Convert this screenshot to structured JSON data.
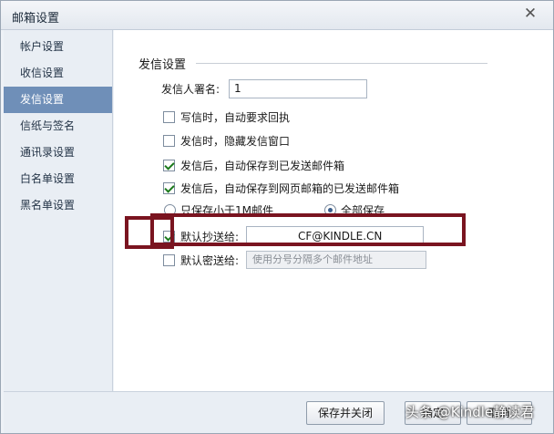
{
  "window": {
    "title": "邮箱设置",
    "close_glyph": "✕"
  },
  "sidebar": {
    "items": [
      {
        "label": "帐户设置",
        "active": false
      },
      {
        "label": "收信设置",
        "active": false
      },
      {
        "label": "发信设置",
        "active": true
      },
      {
        "label": "信纸与签名",
        "active": false
      },
      {
        "label": "通讯录设置",
        "active": false
      },
      {
        "label": "白名单设置",
        "active": false
      },
      {
        "label": "黑名单设置",
        "active": false
      }
    ]
  },
  "main": {
    "section_title": "发信设置",
    "sender_name": {
      "label": "发信人署名:",
      "value": "1"
    },
    "options": [
      {
        "label": "写信时，自动要求回执",
        "checked": false
      },
      {
        "label": "发信时，隐藏发信窗口",
        "checked": false
      },
      {
        "label": "发信后，自动保存到已发送邮件箱",
        "checked": true
      },
      {
        "label": "发信后，自动保存到网页邮箱的已发送邮件箱",
        "checked": true
      }
    ],
    "save_options": [
      {
        "label": "只保存小于1M邮件",
        "selected": false
      },
      {
        "label": "全部保存",
        "selected": true
      }
    ],
    "default_cc": {
      "label": "默认抄送给:",
      "checked": true,
      "value": "CF@KINDLE.CN"
    },
    "default_bcc": {
      "label": "默认密送给:",
      "checked": false,
      "placeholder": "使用分号分隔多个邮件地址"
    }
  },
  "footer": {
    "save_close_label": "保存并关闭",
    "ok_label": "确定",
    "cancel_label": "取消"
  },
  "watermark": "头条 @Kindle静读君",
  "colors": {
    "accent": "#6f8fb8",
    "highlight_box": "#7a1420"
  }
}
